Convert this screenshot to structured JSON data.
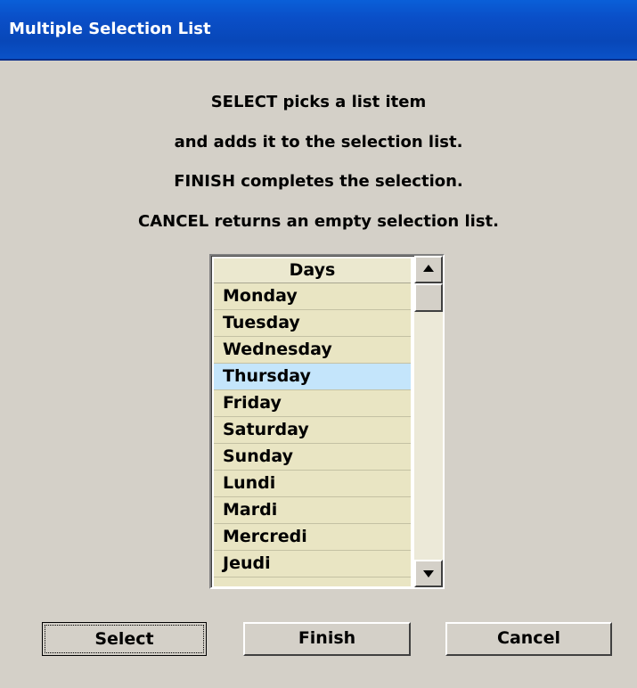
{
  "window": {
    "title": "Multiple Selection List"
  },
  "instructions": [
    "SELECT picks a list item",
    "and adds it to the selection list.",
    "FINISH completes the selection.",
    "CANCEL returns an empty selection list."
  ],
  "list": {
    "header": "Days",
    "items": [
      "Monday",
      "Tuesday",
      "Wednesday",
      "Thursday",
      "Friday",
      "Saturday",
      "Sunday",
      "Lundi",
      "Mardi",
      "Mercredi",
      "Jeudi"
    ],
    "selected": "Thursday",
    "highlight_color": "#c4e5fb",
    "item_bg_color": "#e9e5c3"
  },
  "scrollbar": {
    "up_icon": "scroll-up-arrow-icon",
    "down_icon": "scroll-down-arrow-icon"
  },
  "buttons": {
    "select_label": "Select",
    "finish_label": "Finish",
    "cancel_label": "Cancel"
  }
}
